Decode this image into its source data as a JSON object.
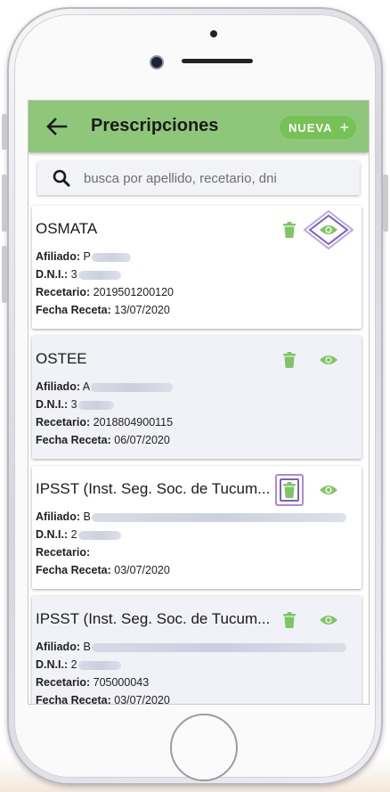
{
  "appbar": {
    "title": "Prescripciones",
    "new_button_label": "NUEVA",
    "new_button_icon": "+"
  },
  "search": {
    "placeholder": "busca por apellido, recetario, dni",
    "value": ""
  },
  "cards": [
    {
      "title": "OSMATA",
      "afiliado_label": "Afiliado:",
      "afiliado_value": "P",
      "dni_label": "D.N.I.:",
      "dni_value": "3",
      "recetario_label": "Recetario:",
      "recetario_value": "2019501200120",
      "fecha_label": "Fecha Receta:",
      "fecha_value": "13/07/2020"
    },
    {
      "title": "OSTEE",
      "afiliado_label": "Afiliado:",
      "afiliado_value": "A",
      "dni_label": "D.N.I.:",
      "dni_value": "3",
      "recetario_label": "Recetario:",
      "recetario_value": "2018804900115",
      "fecha_label": "Fecha Receta:",
      "fecha_value": "06/07/2020"
    },
    {
      "title": "IPSST (Inst. Seg. Soc. de Tucum...",
      "afiliado_label": "Afiliado:",
      "afiliado_value": "B",
      "dni_label": "D.N.I.:",
      "dni_value": "2",
      "recetario_label": "Recetario:",
      "recetario_value": "",
      "fecha_label": "Fecha Receta:",
      "fecha_value": "03/07/2020"
    },
    {
      "title": "IPSST (Inst. Seg. Soc. de Tucum...",
      "afiliado_label": "Afiliado:",
      "afiliado_value": "B",
      "dni_label": "D.N.I.:",
      "dni_value": "2",
      "recetario_label": "Recetario:",
      "recetario_value": "705000043",
      "fecha_label": "Fecha Receta:",
      "fecha_value": "03/07/2020"
    }
  ],
  "colors": {
    "appbar": "#8fc77a",
    "accent_green": "#77c256",
    "highlight_purple": "#7a5fc4"
  }
}
